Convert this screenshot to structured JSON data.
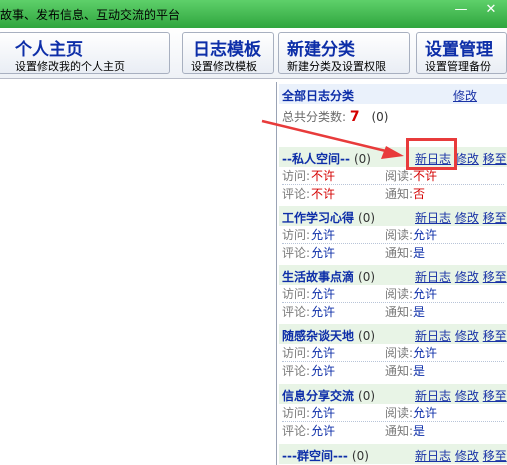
{
  "window": {
    "title": "故事、发布信息、互动交流的平台",
    "min_glyph": "—",
    "close_glyph": "✕"
  },
  "toolbar": [
    {
      "id": "home",
      "title": "个人主页",
      "sub": "设置修改我的个人主页"
    },
    {
      "id": "tpl",
      "title": "日志模板",
      "sub": "设置修改模板"
    },
    {
      "id": "newcat",
      "title": "新建分类",
      "sub": "新建分类及设置权限"
    },
    {
      "id": "admin",
      "title": "设置管理",
      "sub": "设置管理备份"
    }
  ],
  "panel": {
    "header": "全部日志分类",
    "edit_link": "修改",
    "total_label": "总共分类数:",
    "total_num": "7",
    "total_count": "(0)"
  },
  "actions": {
    "new_log": "新日志",
    "edit": "修改",
    "move": "移至"
  },
  "labels": {
    "visit": "访问:",
    "read": "阅读:",
    "comment": "评论:",
    "notify": "通知:"
  },
  "categories": [
    {
      "name": "--私人空间--",
      "count": "(0)",
      "visit": "不许",
      "read": "不许",
      "comment": "不许",
      "notify": "否"
    },
    {
      "name": "工作学习心得",
      "count": "(0)",
      "visit": "允许",
      "read": "允许",
      "comment": "允许",
      "notify": "是"
    },
    {
      "name": "生活故事点滴",
      "count": "(0)",
      "visit": "允许",
      "read": "允许",
      "comment": "允许",
      "notify": "是"
    },
    {
      "name": "随感杂谈天地",
      "count": "(0)",
      "visit": "允许",
      "read": "允许",
      "comment": "允许",
      "notify": "是"
    },
    {
      "name": "信息分享交流",
      "count": "(0)",
      "visit": "允许",
      "read": "允许",
      "comment": "允许",
      "notify": "是"
    },
    {
      "name": "---群空间---",
      "count": "(0)"
    }
  ]
}
